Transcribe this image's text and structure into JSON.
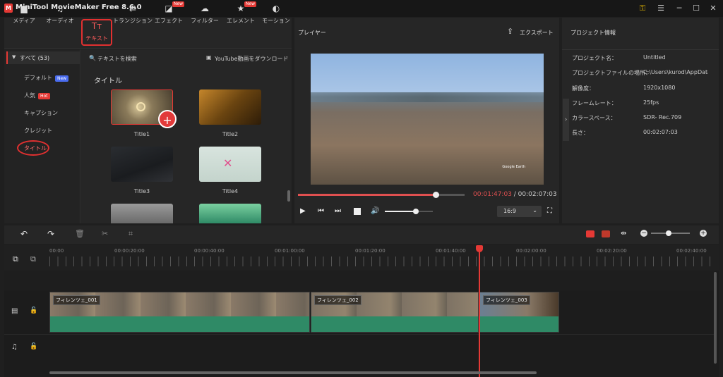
{
  "window": {
    "title": "MiniTool MovieMaker Free 8.6.0",
    "logo": "M"
  },
  "toolbar": {
    "items": [
      {
        "label": "メディア",
        "icon": "folder-icon"
      },
      {
        "label": "オーディオ",
        "icon": "music-icon"
      },
      {
        "label": "テキスト",
        "icon": "text-icon",
        "active": true
      },
      {
        "label": "トランジション",
        "icon": "transition-icon"
      },
      {
        "label": "エフェクト",
        "icon": "effect-icon",
        "badge": "New"
      },
      {
        "label": "フィルター",
        "icon": "filter-icon"
      },
      {
        "label": "エレメント",
        "icon": "element-icon",
        "badge": "New"
      },
      {
        "label": "モーション",
        "icon": "motion-icon"
      }
    ]
  },
  "library": {
    "all_label": "すべて (53)",
    "search_label": "テキストを検索",
    "youtube_label": "YouTube動画をダウンロード",
    "section": "タイトル",
    "categories": [
      {
        "label": "デフォルト",
        "badge": "New"
      },
      {
        "label": "人気",
        "badge": "Hot"
      },
      {
        "label": "キャプション"
      },
      {
        "label": "クレジット"
      },
      {
        "label": "タイトル",
        "selected": true
      }
    ],
    "thumbs": [
      "Title1",
      "Title2",
      "Title3",
      "Title4"
    ]
  },
  "player": {
    "title": "プレイヤー",
    "export": "エクスポート",
    "current_time": "00:01:47:03",
    "sep": " / ",
    "total_time": "00:02:07:03",
    "aspect": "16:9",
    "watermark": "Google Earth",
    "progress": 0.83,
    "volume": 0.65
  },
  "info": {
    "title": "プロジェクト情報",
    "rows": [
      {
        "k": "プロジェクト名：",
        "v": "Untitled"
      },
      {
        "k": "プロジェクトファイルの場所：",
        "v": "C:\\Users\\kurod\\AppData"
      },
      {
        "k": "解像度：",
        "v": "1920x1080"
      },
      {
        "k": "フレームレート：",
        "v": "25fps"
      },
      {
        "k": "カラースペース：",
        "v": "SDR- Rec.709"
      },
      {
        "k": "長さ：",
        "v": "00:02:07:03"
      }
    ]
  },
  "timeline": {
    "ticks": [
      "00:00",
      "00:00:20:00",
      "00:00:40:00",
      "00:01:00:00",
      "00:01:20:00",
      "00:01:40:00",
      "00:02:00:00",
      "00:02:20:00",
      "00:02:40:00"
    ],
    "clips": [
      "フィレンツェ_001",
      "フィレンツェ_002",
      "フィレンツェ_003"
    ],
    "zoom": 0.45
  },
  "colors": {
    "accent": "#e53935",
    "clip": "#2f8a66",
    "progress": "#e05050"
  }
}
